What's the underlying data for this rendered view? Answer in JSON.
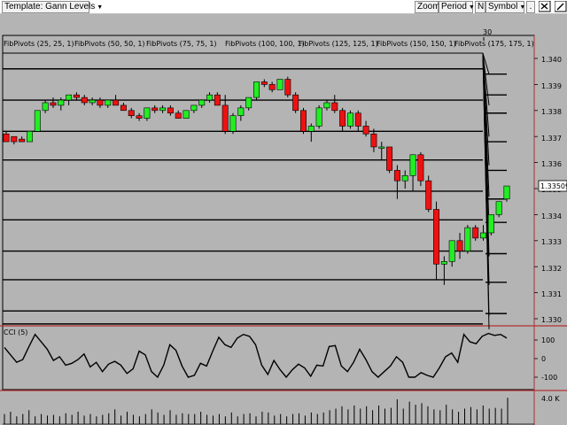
{
  "toolbar": {
    "template_label": "Template: Gann Levels",
    "zoom_label": "Zoom",
    "period_label": "Period",
    "n_label": "N",
    "symbol_label": "Symbol",
    "dot_label": "."
  },
  "icons": {
    "dropdown": "chevron-down-icon",
    "close": "close-icon"
  },
  "colors": {
    "background": "#b4b4b4",
    "bull": "#22ee22",
    "bear": "#ee1111",
    "line": "#000000",
    "separator": "#b03030"
  },
  "chart": {
    "session_marker": "30",
    "last_price": "1.33509",
    "price_scale": [
      "1.340",
      "1.339",
      "1.338",
      "1.337",
      "1.336",
      "1.335",
      "1.334",
      "1.333",
      "1.332",
      "1.331",
      "1.330"
    ],
    "pivot_labels": [
      "FibPivots (25, 25, 1)",
      "FibPivots (50, 50, 1)",
      "FibPivots (75, 75, 1)",
      "FibPivots (100, 100, 1)",
      "FibPivots (125, 125, 1)",
      "FibPivots (150, 150, 1)",
      "FibPivots (175, 175, 1)"
    ]
  },
  "cci": {
    "label": "CCI (5)",
    "scale": [
      "100",
      "0",
      "-100"
    ]
  },
  "volume": {
    "scale_label": "4.0 K"
  },
  "chart_data": {
    "type": "candlestick",
    "y_range": [
      1.3295,
      1.3405
    ],
    "candles": [
      [
        1.3371,
        1.3372,
        1.3369,
        1.3368
      ],
      [
        1.337,
        1.337,
        1.3367,
        1.3368
      ],
      [
        1.3369,
        1.337,
        1.3368,
        1.3368
      ],
      [
        1.3368,
        1.3372,
        1.3368,
        1.3372
      ],
      [
        1.3372,
        1.338,
        1.3372,
        1.338
      ],
      [
        1.338,
        1.3384,
        1.3379,
        1.3383
      ],
      [
        1.3383,
        1.3385,
        1.3381,
        1.3382
      ],
      [
        1.3382,
        1.3385,
        1.338,
        1.3384
      ],
      [
        1.3384,
        1.3386,
        1.3382,
        1.3386
      ],
      [
        1.3386,
        1.3387,
        1.3384,
        1.3385
      ],
      [
        1.3385,
        1.3386,
        1.3382,
        1.3383
      ],
      [
        1.3383,
        1.3385,
        1.3382,
        1.3384
      ],
      [
        1.3384,
        1.3385,
        1.3381,
        1.3382
      ],
      [
        1.3382,
        1.3384,
        1.3381,
        1.3384
      ],
      [
        1.3384,
        1.3386,
        1.3382,
        1.3382
      ],
      [
        1.3382,
        1.3383,
        1.338,
        1.338
      ],
      [
        1.338,
        1.3381,
        1.3377,
        1.3378
      ],
      [
        1.3378,
        1.3379,
        1.3376,
        1.3377
      ],
      [
        1.3377,
        1.3381,
        1.3376,
        1.3381
      ],
      [
        1.3381,
        1.3382,
        1.3379,
        1.338
      ],
      [
        1.338,
        1.3382,
        1.3379,
        1.3381
      ],
      [
        1.3381,
        1.3382,
        1.3378,
        1.3379
      ],
      [
        1.3379,
        1.338,
        1.3377,
        1.3377
      ],
      [
        1.3377,
        1.338,
        1.3377,
        1.338
      ],
      [
        1.338,
        1.3382,
        1.3379,
        1.3382
      ],
      [
        1.3382,
        1.3384,
        1.3381,
        1.3384
      ],
      [
        1.3384,
        1.3387,
        1.3383,
        1.3386
      ],
      [
        1.3386,
        1.3387,
        1.3382,
        1.3382
      ],
      [
        1.3382,
        1.3386,
        1.3371,
        1.3372
      ],
      [
        1.3372,
        1.3379,
        1.3371,
        1.3378
      ],
      [
        1.3378,
        1.3382,
        1.3376,
        1.3381
      ],
      [
        1.3381,
        1.3385,
        1.338,
        1.3385
      ],
      [
        1.3385,
        1.3391,
        1.3384,
        1.3391
      ],
      [
        1.3391,
        1.3392,
        1.3389,
        1.339
      ],
      [
        1.339,
        1.3391,
        1.3387,
        1.3388
      ],
      [
        1.3388,
        1.3392,
        1.3388,
        1.3392
      ],
      [
        1.3392,
        1.3393,
        1.3385,
        1.3386
      ],
      [
        1.3386,
        1.3387,
        1.3379,
        1.338
      ],
      [
        1.338,
        1.3381,
        1.3371,
        1.3372
      ],
      [
        1.3372,
        1.3375,
        1.3368,
        1.3374
      ],
      [
        1.3374,
        1.3382,
        1.3373,
        1.3381
      ],
      [
        1.3381,
        1.3384,
        1.338,
        1.3383
      ],
      [
        1.3383,
        1.3386,
        1.3379,
        1.338
      ],
      [
        1.338,
        1.3381,
        1.3372,
        1.3374
      ],
      [
        1.3374,
        1.338,
        1.3373,
        1.3379
      ],
      [
        1.3379,
        1.338,
        1.3372,
        1.3374
      ],
      [
        1.3374,
        1.3376,
        1.337,
        1.3371
      ],
      [
        1.3371,
        1.3373,
        1.3364,
        1.3366
      ],
      [
        1.3366,
        1.3368,
        1.3361,
        1.3366
      ],
      [
        1.3366,
        1.3366,
        1.3356,
        1.3357
      ],
      [
        1.3357,
        1.3359,
        1.3346,
        1.3353
      ],
      [
        1.3353,
        1.3357,
        1.335,
        1.3355
      ],
      [
        1.3355,
        1.3363,
        1.3349,
        1.3363
      ],
      [
        1.3363,
        1.3364,
        1.3351,
        1.3353
      ],
      [
        1.3353,
        1.3355,
        1.3341,
        1.3342
      ],
      [
        1.3342,
        1.3345,
        1.3315,
        1.3321
      ],
      [
        1.3321,
        1.3324,
        1.3313,
        1.3322
      ],
      [
        1.3322,
        1.333,
        1.332,
        1.333
      ],
      [
        1.333,
        1.3333,
        1.3323,
        1.3326
      ],
      [
        1.3326,
        1.3336,
        1.3325,
        1.3335
      ],
      [
        1.3335,
        1.3336,
        1.333,
        1.3331
      ],
      [
        1.3331,
        1.3336,
        1.333,
        1.3333
      ],
      [
        1.3333,
        1.334,
        1.3332,
        1.334
      ],
      [
        1.334,
        1.3345,
        1.3339,
        1.3345
      ],
      [
        1.3346,
        1.3351,
        1.3345,
        1.3351
      ]
    ],
    "cci": [
      60,
      20,
      -20,
      -5,
      65,
      130,
      90,
      50,
      -10,
      10,
      -35,
      -25,
      -5,
      25,
      -45,
      -20,
      -70,
      -30,
      -15,
      -35,
      -80,
      -55,
      40,
      20,
      -70,
      -100,
      -35,
      75,
      45,
      -40,
      -100,
      -90,
      -25,
      -40,
      40,
      115,
      75,
      60,
      110,
      130,
      120,
      75,
      -35,
      -85,
      -10,
      -60,
      -100,
      -60,
      -30,
      -50,
      -95,
      -35,
      -40,
      65,
      70,
      -40,
      -70,
      -20,
      50,
      -5,
      -70,
      -100,
      -70,
      -40,
      10,
      -20,
      -100,
      -100,
      -75,
      -90,
      -100,
      -50,
      10,
      30,
      -20,
      130,
      90,
      80,
      120,
      135,
      125,
      130,
      110
    ],
    "volume": [
      1.3,
      1.6,
      1.0,
      1.3,
      1.8,
      1.0,
      1.3,
      1.1,
      1.2,
      1.0,
      1.4,
      1.2,
      1.6,
      1.1,
      1.3,
      1.0,
      1.2,
      1.4,
      1.9,
      1.1,
      1.6,
      1.2,
      1.0,
      1.3,
      1.9,
      1.5,
      1.2,
      1.8,
      1.2,
      1.4,
      1.3,
      1.3,
      1.6,
      1.2,
      1.1,
      1.3,
      1.0,
      1.5,
      1.0,
      1.3,
      1.4,
      1.0,
      1.6,
      1.5,
      1.1,
      1.3,
      1.0,
      1.3,
      1.4,
      1.1,
      1.5,
      1.3,
      1.5,
      1.8,
      2.0,
      2.3,
      1.9,
      2.4,
      2.0,
      2.3,
      1.8,
      2.4,
      2.0,
      2.1,
      3.2,
      2.0,
      2.9,
      2.5,
      2.7,
      2.3,
      1.9,
      1.8,
      2.5,
      1.9,
      1.6,
      2.0,
      2.2,
      1.9,
      2.4,
      2.0,
      2.1,
      2.0,
      3.4
    ]
  }
}
